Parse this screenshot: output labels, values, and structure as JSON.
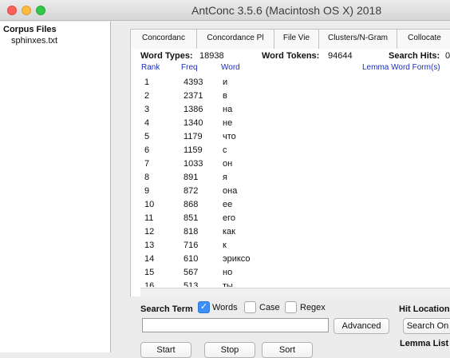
{
  "window": {
    "title": "AntConc 3.5.6 (Macintosh OS X) 2018"
  },
  "left_panel": {
    "header": "Corpus Files",
    "files": [
      "sphinxes.txt"
    ]
  },
  "tabs": [
    "Concordanc",
    "Concordance Pl",
    "File Vie",
    "Clusters/N-Gram",
    "Collocate"
  ],
  "stats": {
    "types_label": "Word Types:",
    "types_value": "18938",
    "tokens_label": "Word Tokens:",
    "tokens_value": "94644",
    "hits_label": "Search Hits:",
    "hits_value": "0"
  },
  "columns": {
    "rank": "Rank",
    "freq": "Freq",
    "word": "Word",
    "lemma": "Lemma Word Form(s)"
  },
  "rows": [
    {
      "rank": "1",
      "freq": "4393",
      "word": "и"
    },
    {
      "rank": "2",
      "freq": "2371",
      "word": "в"
    },
    {
      "rank": "3",
      "freq": "1386",
      "word": "на"
    },
    {
      "rank": "4",
      "freq": "1340",
      "word": "не"
    },
    {
      "rank": "5",
      "freq": "1179",
      "word": "что"
    },
    {
      "rank": "6",
      "freq": "1159",
      "word": "с"
    },
    {
      "rank": "7",
      "freq": "1033",
      "word": "он"
    },
    {
      "rank": "8",
      "freq": "891",
      "word": "я"
    },
    {
      "rank": "9",
      "freq": "872",
      "word": "она"
    },
    {
      "rank": "10",
      "freq": "868",
      "word": "ее"
    },
    {
      "rank": "11",
      "freq": "851",
      "word": "его"
    },
    {
      "rank": "12",
      "freq": "818",
      "word": "как"
    },
    {
      "rank": "13",
      "freq": "716",
      "word": "к"
    },
    {
      "rank": "14",
      "freq": "610",
      "word": "эриксо"
    },
    {
      "rank": "15",
      "freq": "567",
      "word": "но"
    },
    {
      "rank": "16",
      "freq": "513",
      "word": "ты"
    }
  ],
  "search": {
    "label": "Search Term",
    "words_label": "Words",
    "words_checked": true,
    "case_label": "Case",
    "case_checked": false,
    "regex_label": "Regex",
    "regex_checked": false,
    "input_value": "",
    "advanced_label": "Advanced",
    "hit_location_label": "Hit Location",
    "search_only_label": "Search On",
    "lemma_list_label": "Lemma List"
  },
  "buttons": {
    "start": "Start",
    "stop": "Stop",
    "sort": "Sort"
  }
}
